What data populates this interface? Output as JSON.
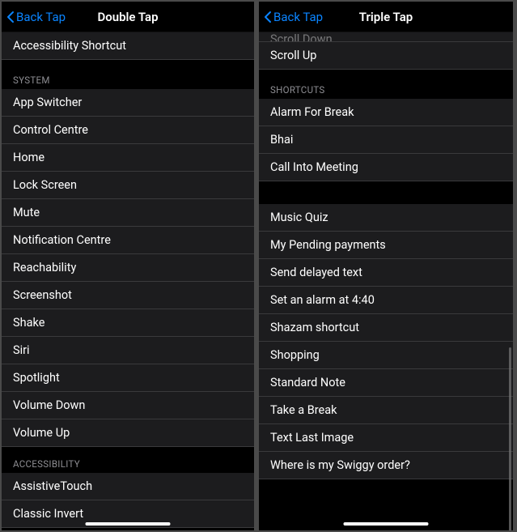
{
  "left": {
    "back_label": "Back Tap",
    "title": "Double Tap",
    "top_item": "Accessibility Shortcut",
    "sections": [
      {
        "header": "SYSTEM",
        "items": [
          "App Switcher",
          "Control Centre",
          "Home",
          "Lock Screen",
          "Mute",
          "Notification Centre",
          "Reachability",
          "Screenshot",
          "Shake",
          "Siri",
          "Spotlight",
          "Volume Down",
          "Volume Up"
        ]
      },
      {
        "header": "ACCESSIBILITY",
        "items": [
          "AssistiveTouch",
          "Classic Invert"
        ]
      }
    ]
  },
  "right": {
    "back_label": "Back Tap",
    "title": "Triple Tap",
    "partial_top": "Scroll Down",
    "pre_items": [
      "Scroll Up"
    ],
    "sections": [
      {
        "header": "SHORTCUTS",
        "items": [
          "Alarm For Break",
          "Bhai",
          "Call Into Meeting"
        ]
      },
      {
        "header": "",
        "items": [
          "Music Quiz",
          "My Pending payments",
          "Send delayed text",
          "Set an alarm at 4:40",
          "Shazam shortcut",
          "Shopping",
          "Standard Note",
          "Take a Break",
          "Text Last Image",
          "Where is my Swiggy order?"
        ]
      }
    ]
  }
}
